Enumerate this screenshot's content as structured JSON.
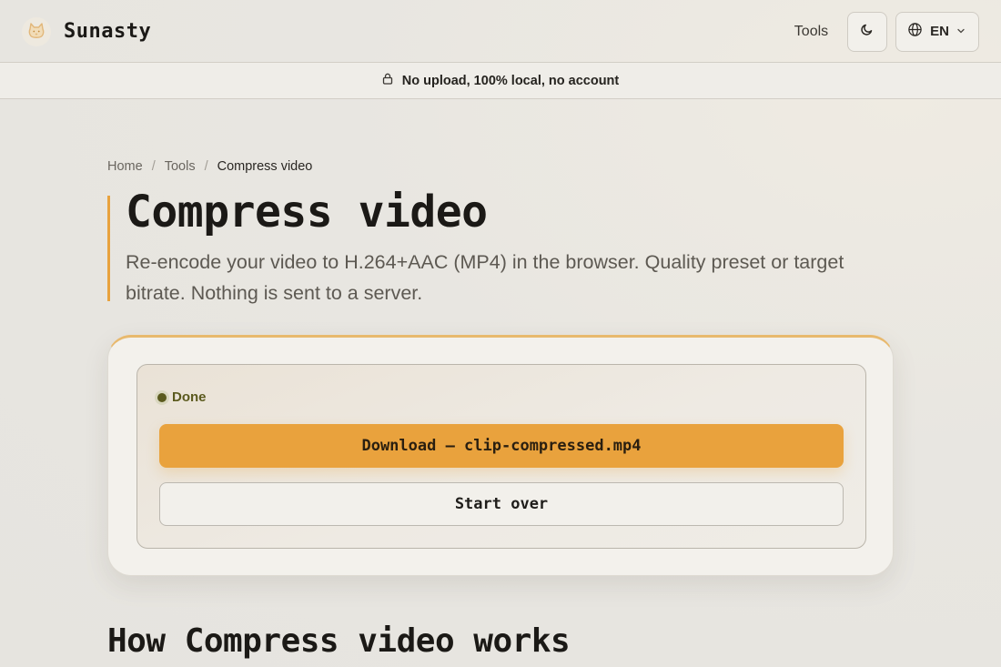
{
  "header": {
    "brand": "Sunasty",
    "logo_icon": "cat-icon",
    "nav_tools": "Tools",
    "theme_icon": "moon-icon",
    "language": "EN",
    "language_icon": "globe-icon"
  },
  "privacy": {
    "icon": "lock-icon",
    "text": "No upload, 100% local, no account"
  },
  "breadcrumb": {
    "items": [
      "Home",
      "Tools",
      "Compress video"
    ],
    "separator": "/"
  },
  "page": {
    "title": "Compress video",
    "description": "Re-encode your video to H.264+AAC (MP4) in the browser. Quality preset or target bitrate. Nothing is sent to a server."
  },
  "result": {
    "status": "Done",
    "download_label": "Download — clip-compressed.mp4",
    "start_over_label": "Start over"
  },
  "section": {
    "heading": "How Compress video works"
  },
  "colors": {
    "accent": "#e9a23d",
    "status_done": "#5b5a1e",
    "background": "#e8e6e1"
  }
}
